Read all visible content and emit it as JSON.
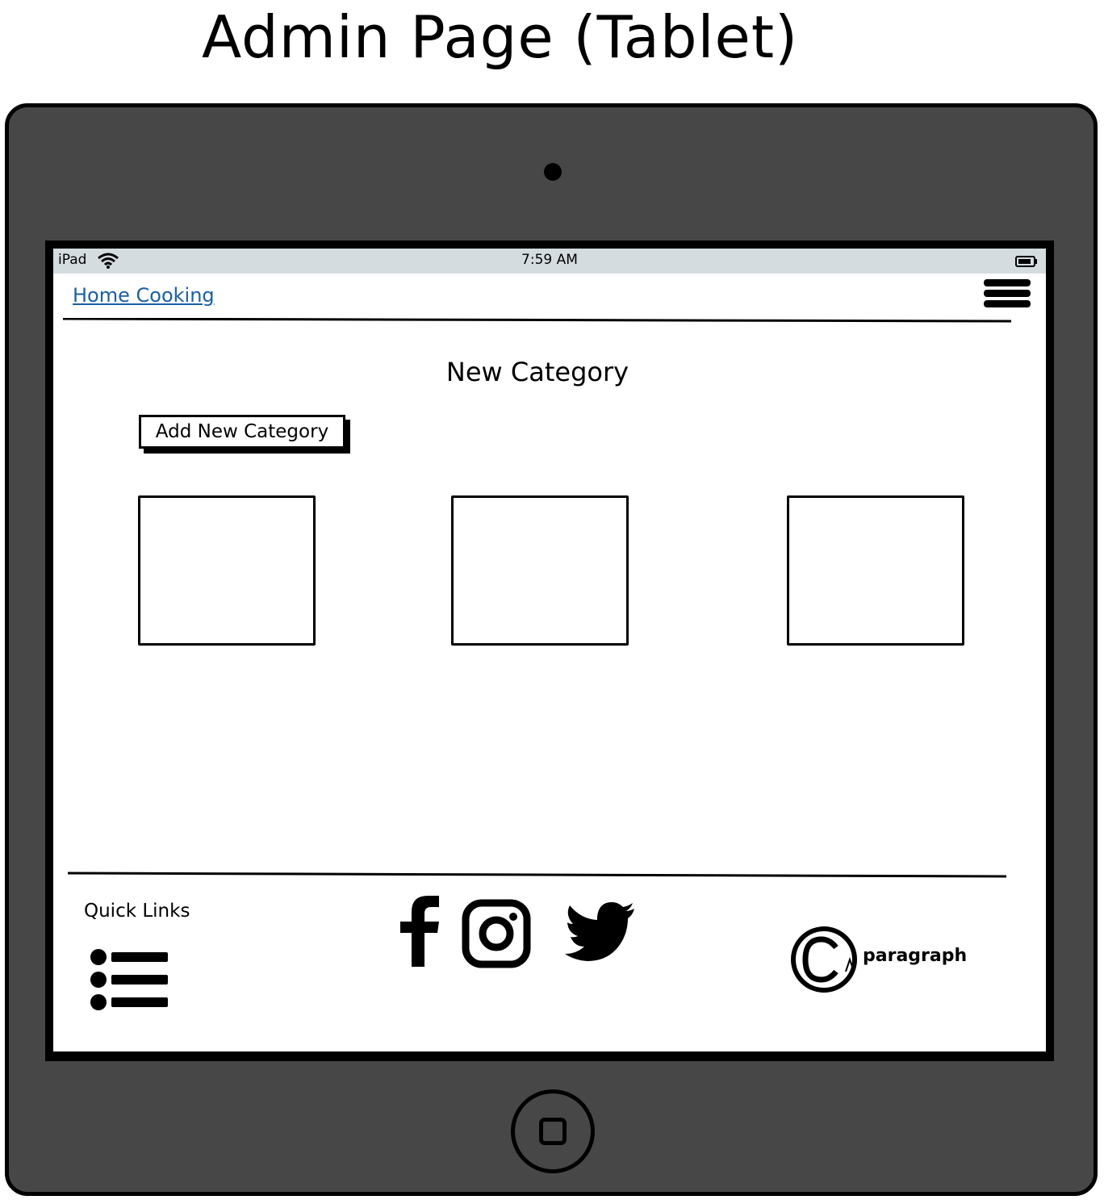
{
  "page": {
    "title": "Admin Page (Tablet)"
  },
  "status_bar": {
    "device": "iPad",
    "time": "7:59 AM",
    "icons": [
      "wifi-icon",
      "battery-icon"
    ]
  },
  "navbar": {
    "brand": "Home Cooking",
    "menu_icon": "hamburger-menu-icon"
  },
  "main": {
    "heading": "New Category",
    "add_button_label": "Add New Category",
    "cards": [
      {
        "label": ""
      },
      {
        "label": ""
      },
      {
        "label": ""
      }
    ]
  },
  "footer": {
    "quick_links_label": "Quick Links",
    "social_icons": [
      "facebook-icon",
      "instagram-icon",
      "twitter-icon"
    ],
    "copyright_text": "paragraph"
  },
  "colors": {
    "tablet_body": "#474747",
    "status_bar": "#d5dce0",
    "link": "#1a5fa8"
  }
}
